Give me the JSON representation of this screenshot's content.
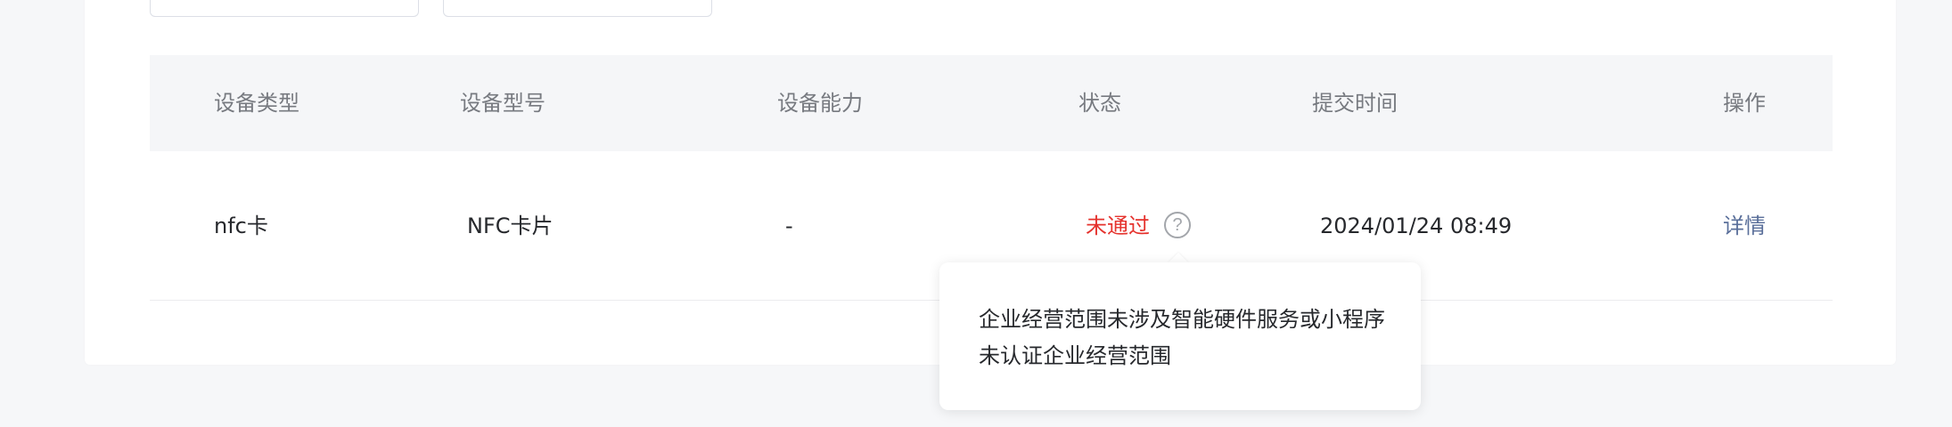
{
  "table": {
    "headers": {
      "device_type": "设备类型",
      "device_model": "设备型号",
      "device_capability": "设备能力",
      "status": "状态",
      "submit_time": "提交时间",
      "action": "操作"
    },
    "rows": [
      {
        "device_type": "nfc卡",
        "device_model": "NFC卡片",
        "device_capability": "-",
        "status": "未通过",
        "submit_time": "2024/01/24 08:49",
        "action": "详情"
      }
    ]
  },
  "tooltip": {
    "text": "企业经营范围未涉及智能硬件服务或小程序未认证企业经营范围"
  },
  "icons": {
    "help": "question-circle-icon",
    "help_glyph": "?"
  },
  "colors": {
    "status_rejected": "#e5322d",
    "link": "#5a6f9a",
    "header_bg": "#f5f6f8"
  }
}
